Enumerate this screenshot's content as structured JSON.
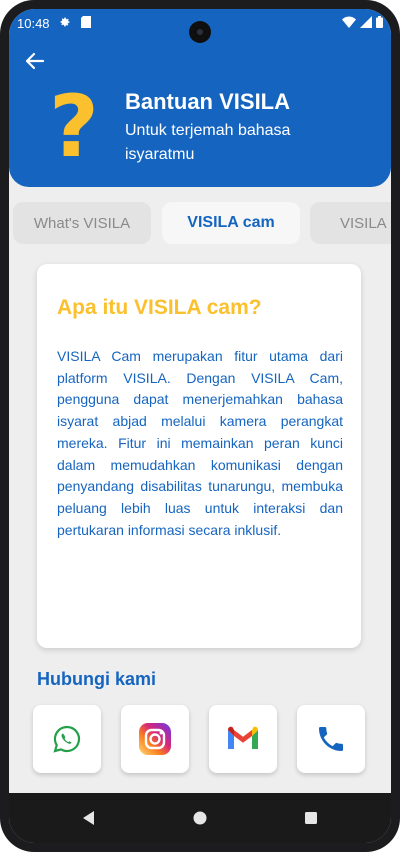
{
  "status": {
    "time": "10:48"
  },
  "header": {
    "title": "Bantuan VISILA",
    "subtitle": "Untuk terjemah bahasa isyaratmu",
    "help_glyph": "?"
  },
  "tabs": [
    {
      "label": "What's VISILA",
      "active": false
    },
    {
      "label": "VISILA cam",
      "active": true
    },
    {
      "label": "VISILA",
      "active": false
    }
  ],
  "card": {
    "title": "Apa itu VISILA cam?",
    "body": "VISILA Cam merupakan fitur utama dari platform VISILA. Dengan VISILA Cam, pengguna dapat menerjemahkan bahasa isyarat abjad melalui kamera perangkat mereka. Fitur ini memainkan peran kunci dalam memudahkan komunikasi dengan penyandang disabilitas tunarungu, membuka peluang lebih luas untuk interaksi dan pertukaran informasi secara inklusif."
  },
  "contact": {
    "title": "Hubungi kami",
    "items": [
      {
        "icon": "whatsapp-icon"
      },
      {
        "icon": "instagram-icon"
      },
      {
        "icon": "gmail-icon"
      },
      {
        "icon": "phone-icon"
      }
    ]
  },
  "colors": {
    "primary": "#1565c0",
    "accent": "#fbc02d",
    "background": "#eeeeee"
  }
}
